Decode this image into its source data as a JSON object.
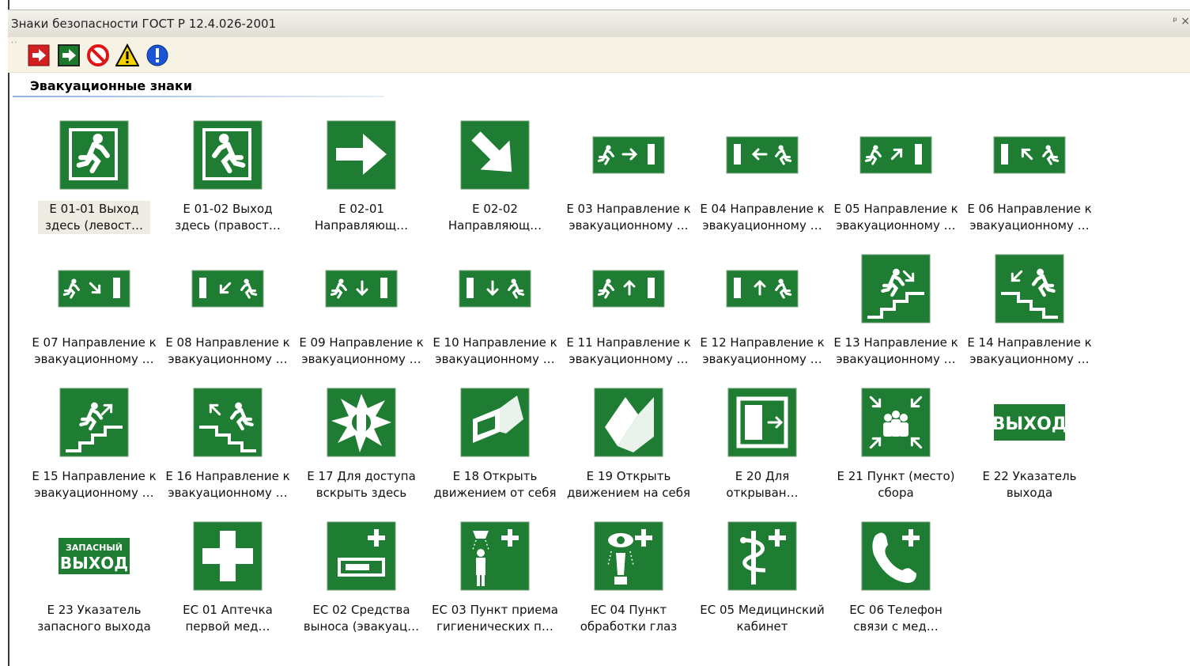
{
  "window": {
    "title": "Знаки безопасности  ГОСТ Р 12.4.026-2001"
  },
  "toolbar": {
    "buttons": [
      {
        "name": "exit-red-icon",
        "color": "#d21f1f"
      },
      {
        "name": "exit-green-icon",
        "color": "#1a7a2a"
      },
      {
        "name": "prohibition-icon",
        "color": "#e01414"
      },
      {
        "name": "warning-icon",
        "color": "#f5d300"
      },
      {
        "name": "mandatory-icon",
        "color": "#1a55d6"
      }
    ]
  },
  "group": {
    "title": "Эвакуационные знаки"
  },
  "colors": {
    "sign_green": "#1e7d32",
    "sign_white": "#ffffff",
    "selection": "#eeebe2"
  },
  "items": [
    {
      "l1": "Е 01-01 Выход",
      "l2": "здесь (левост…",
      "icon": "exit-running-man-left-icon"
    },
    {
      "l1": "Е 01-02 Выход",
      "l2": "здесь (правост…",
      "icon": "exit-running-man-right-icon"
    },
    {
      "l1": "Е 02-01",
      "l2": "Направляющ…",
      "icon": "arrow-right-icon"
    },
    {
      "l1": "Е 02-02",
      "l2": "Направляющ…",
      "icon": "arrow-down-right-icon"
    },
    {
      "l1": "Е 03 Направление к",
      "l2": "эвакуационному …",
      "icon": "direction-right-icon"
    },
    {
      "l1": "Е 04 Направление к",
      "l2": "эвакуационному …",
      "icon": "direction-left-icon"
    },
    {
      "l1": "Е 05 Направление к",
      "l2": "эвакуационному …",
      "icon": "direction-up-right-icon"
    },
    {
      "l1": "Е 06 Направление к",
      "l2": "эвакуационному …",
      "icon": "direction-up-left-icon"
    },
    {
      "l1": "Е 07 Направление к",
      "l2": "эвакуационному …",
      "icon": "direction-down-right-icon"
    },
    {
      "l1": "Е 08 Направление к",
      "l2": "эвакуационному …",
      "icon": "direction-down-left-icon"
    },
    {
      "l1": "Е 09 Направление к",
      "l2": "эвакуационному …",
      "icon": "direction-down-icon"
    },
    {
      "l1": "Е 10 Направление к",
      "l2": "эвакуационному …",
      "icon": "direction-down-icon-2"
    },
    {
      "l1": "Е 11 Направление к",
      "l2": "эвакуационному …",
      "icon": "direction-up-icon"
    },
    {
      "l1": "Е 12 Направление к",
      "l2": "эвакуационному …",
      "icon": "direction-up-icon-2"
    },
    {
      "l1": "Е 13 Направление к",
      "l2": "эвакуационному …",
      "icon": "stairs-down-right-icon"
    },
    {
      "l1": "Е 14 Направление к",
      "l2": "эвакуационному …",
      "icon": "stairs-down-left-icon"
    },
    {
      "l1": "Е 15 Направление к",
      "l2": "эвакуационному …",
      "icon": "stairs-up-right-icon"
    },
    {
      "l1": "Е 16 Направление к",
      "l2": "эвакуационному …",
      "icon": "stairs-up-left-icon"
    },
    {
      "l1": "Е 17 Для доступа",
      "l2": "вскрыть здесь",
      "icon": "break-glass-icon"
    },
    {
      "l1": "Е 18 Открыть",
      "l2": "движением от себя",
      "icon": "push-door-icon"
    },
    {
      "l1": "Е 19 Открыть",
      "l2": "движением на себя",
      "icon": "pull-door-icon"
    },
    {
      "l1": "Е 20 Для",
      "l2": "открыван…",
      "icon": "sliding-door-icon"
    },
    {
      "l1": "Е 21 Пункт (место)",
      "l2": "сбора",
      "icon": "assembly-point-icon"
    },
    {
      "l1": "Е 22 Указатель",
      "l2": "выхода",
      "icon": "exit-text-icon",
      "text": "ВЫХОД"
    },
    {
      "l1": "Е 23 Указатель",
      "l2": "запасного выхода",
      "icon": "emergency-exit-text-icon",
      "text_top": "ЗАПАСНЫЙ",
      "text": "ВЫХОД"
    },
    {
      "l1": "ЕС 01 Аптечка",
      "l2": "первой мед…",
      "icon": "first-aid-cross-icon"
    },
    {
      "l1": "ЕС 02 Средства",
      "l2": "выноса (эвакуац…",
      "icon": "stretcher-icon"
    },
    {
      "l1": "ЕС 03 Пункт приема",
      "l2": "гигиенических п…",
      "icon": "shower-icon"
    },
    {
      "l1": "ЕС 04 Пункт",
      "l2": "обработки глаз",
      "icon": "eye-wash-icon"
    },
    {
      "l1": "ЕС 05 Медицинский",
      "l2": "кабинет",
      "icon": "medical-office-icon"
    },
    {
      "l1": "ЕС 06 Телефон",
      "l2": "связи с мед…",
      "icon": "phone-icon"
    }
  ]
}
